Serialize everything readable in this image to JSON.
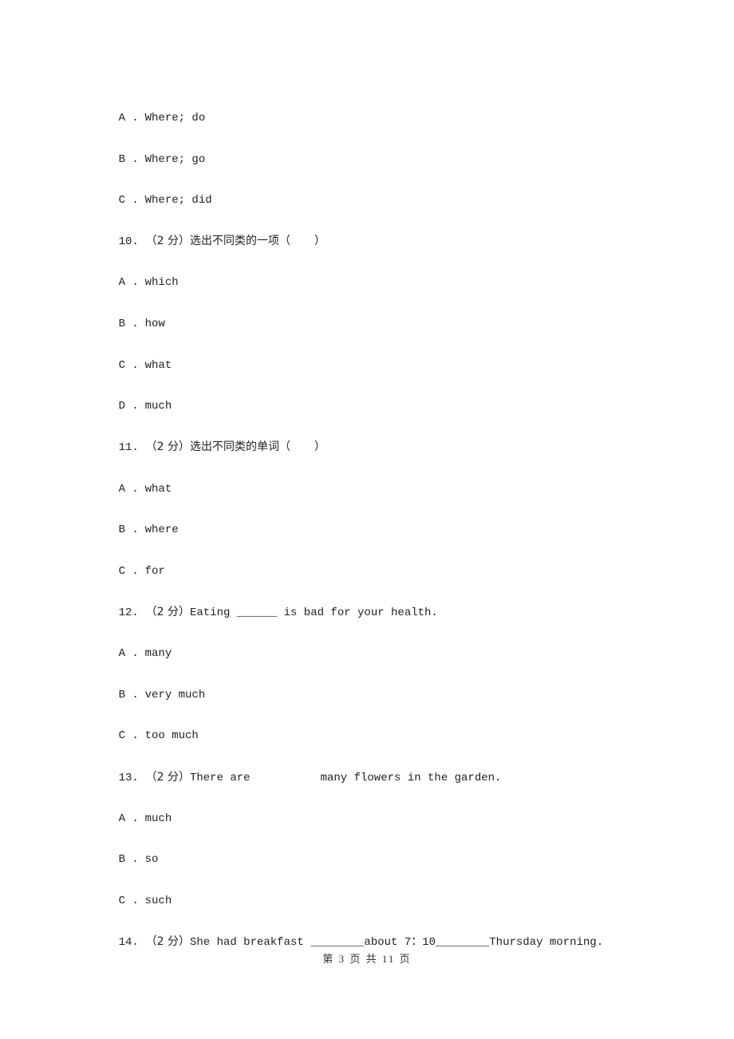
{
  "continuation_options": [
    {
      "letter": "A .",
      "text": "Where; do"
    },
    {
      "letter": "B .",
      "text": "Where; go"
    },
    {
      "letter": "C .",
      "text": "Where; did"
    }
  ],
  "questions": [
    {
      "number": "10.",
      "points": "（2 分）",
      "prompt": "选出不同类的一项（",
      "prompt_end": "）",
      "options": [
        {
          "letter": "A .",
          "text": "which"
        },
        {
          "letter": "B .",
          "text": "how"
        },
        {
          "letter": "C .",
          "text": "what"
        },
        {
          "letter": "D .",
          "text": "much"
        }
      ]
    },
    {
      "number": "11.",
      "points": "（2 分）",
      "prompt": "选出不同类的单词（",
      "prompt_end": "）",
      "options": [
        {
          "letter": "A .",
          "text": "what"
        },
        {
          "letter": "B .",
          "text": "where"
        },
        {
          "letter": "C .",
          "text": "for"
        }
      ]
    },
    {
      "number": "12.",
      "points": "（2 分）",
      "prompt_before": "Eating ",
      "blank": "______",
      "prompt_after": " is bad for your health.",
      "options": [
        {
          "letter": "A .",
          "text": "many"
        },
        {
          "letter": "B .",
          "text": "very much"
        },
        {
          "letter": "C .",
          "text": "too much"
        }
      ]
    },
    {
      "number": "13.",
      "points": "（2 分）",
      "prompt_before": "There are",
      "prompt_after": "many flowers in the garden.",
      "options": [
        {
          "letter": "A .",
          "text": "much"
        },
        {
          "letter": "B .",
          "text": "so"
        },
        {
          "letter": "C .",
          "text": "such"
        }
      ]
    },
    {
      "number": "14.",
      "points": "（2 分）",
      "prompt_before": "She had breakfast ",
      "blank1": "________",
      "prompt_middle": "about 7：10",
      "blank2": "________",
      "prompt_after": "Thursday morning."
    }
  ],
  "footer": {
    "page_label": "第 3 页 共 11 页"
  }
}
